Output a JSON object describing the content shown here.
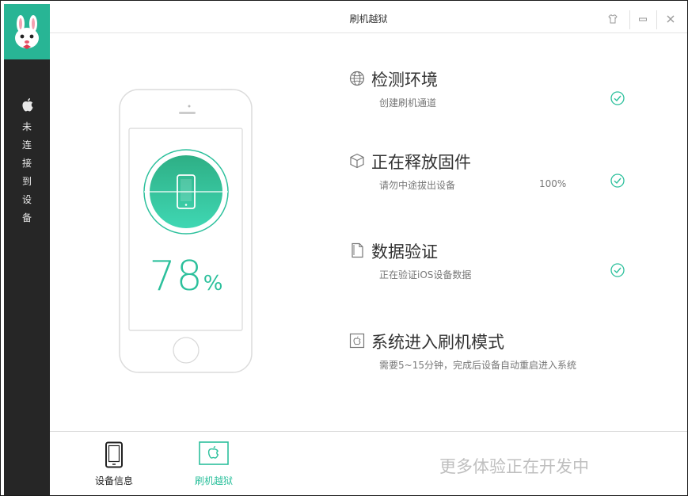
{
  "window": {
    "title": "刷机越狱"
  },
  "sidebar": {
    "status_chars": [
      "未",
      "连",
      "接",
      "到",
      "设",
      "备"
    ]
  },
  "progress": {
    "percent_value": 78,
    "percent_text": "78",
    "percent_sign": "%"
  },
  "steps": [
    {
      "icon": "globe-icon",
      "title": "检测环境",
      "subtitle": "创建刷机通道",
      "percent": "",
      "done": true
    },
    {
      "icon": "box-icon",
      "title": "正在释放固件",
      "subtitle": "请勿中途拔出设备",
      "percent": "100%",
      "done": true
    },
    {
      "icon": "document-icon",
      "title": "数据验证",
      "subtitle": "正在验证iOS设备数据",
      "percent": "",
      "done": true
    },
    {
      "icon": "apple-box-icon",
      "title": "系统进入刷机模式",
      "subtitle": "需要5~15分钟，完成后设备自动重启进入系统",
      "percent": "",
      "done": false
    }
  ],
  "bottom_nav": {
    "device_info": "设备信息",
    "flash_jailbreak": "刷机越狱",
    "coming_soon": "更多体验正在开发中"
  },
  "colors": {
    "accent": "#2cc09c",
    "sidebar_bg": "#262626",
    "logo_bg": "#28b595"
  }
}
